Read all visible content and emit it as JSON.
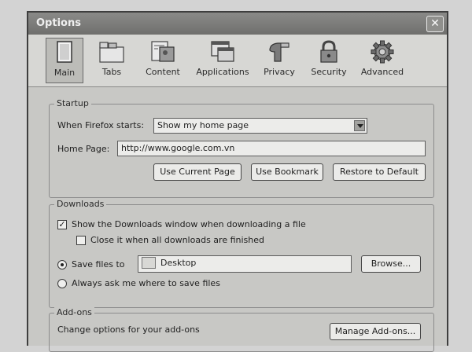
{
  "window": {
    "title": "Options",
    "close": "✕"
  },
  "toolbar": [
    {
      "label": "Main",
      "icon": "main-icon"
    },
    {
      "label": "Tabs",
      "icon": "tabs-icon"
    },
    {
      "label": "Content",
      "icon": "content-icon"
    },
    {
      "label": "Applications",
      "icon": "applications-icon"
    },
    {
      "label": "Privacy",
      "icon": "privacy-icon"
    },
    {
      "label": "Security",
      "icon": "security-icon"
    },
    {
      "label": "Advanced",
      "icon": "advanced-icon"
    }
  ],
  "startup": {
    "legend": "Startup",
    "when_label": "When Firefox starts:",
    "when_value": "Show my home page",
    "home_label": "Home Page:",
    "home_value": "http://www.google.com.vn",
    "use_current": "Use Current Page",
    "use_bookmark": "Use Bookmark",
    "restore_default": "Restore to Default"
  },
  "downloads": {
    "legend": "Downloads",
    "show_window": "Show the Downloads window when downloading a file",
    "show_window_checked": true,
    "close_it": "Close it when all downloads are finished",
    "close_it_checked": false,
    "save_files": "Save files to",
    "save_files_selected": true,
    "folder": "Desktop",
    "browse": "Browse...",
    "always_ask": "Always ask me where to save files",
    "always_ask_selected": false
  },
  "addons": {
    "legend": "Add-ons",
    "description": "Change options for your add-ons",
    "manage": "Manage Add-ons..."
  }
}
